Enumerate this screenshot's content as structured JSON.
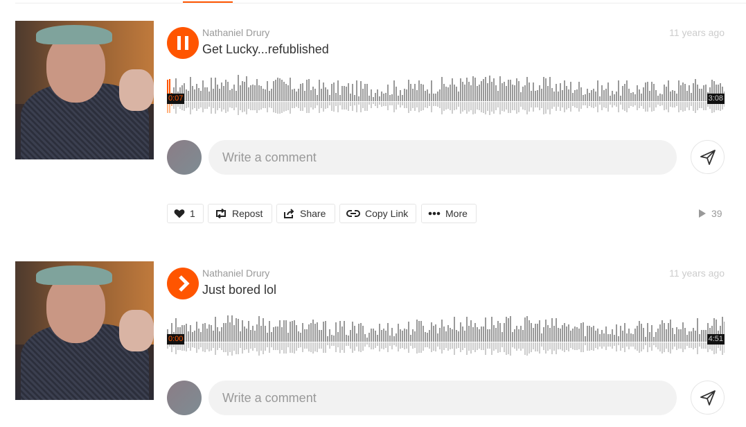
{
  "tracks": [
    {
      "artist": "Nathaniel Drury",
      "title": "Get Lucky...refublished",
      "date": "11 years ago",
      "state": "playing",
      "current_time": "0:07",
      "duration": "3:08",
      "progress": 0.009,
      "comment_placeholder": "Write a comment",
      "likes": "1",
      "repost": "Repost",
      "share": "Share",
      "copy_link": "Copy Link",
      "more": "More",
      "plays": "39",
      "icons": [
        "pause-icon",
        "heart-icon",
        "repost-icon",
        "share-icon",
        "link-icon",
        "more-icon",
        "play-count-icon",
        "send-icon"
      ]
    },
    {
      "artist": "Nathaniel Drury",
      "title": "Just bored lol",
      "date": "11 years ago",
      "state": "paused",
      "current_time": "0:00",
      "duration": "4:51",
      "comment_placeholder": "Write a comment",
      "icons": [
        "play-icon",
        "send-icon"
      ]
    }
  ],
  "colors": {
    "accent": "#ff5500",
    "wave": "#999999",
    "wave_reflection": "#cccccc"
  }
}
